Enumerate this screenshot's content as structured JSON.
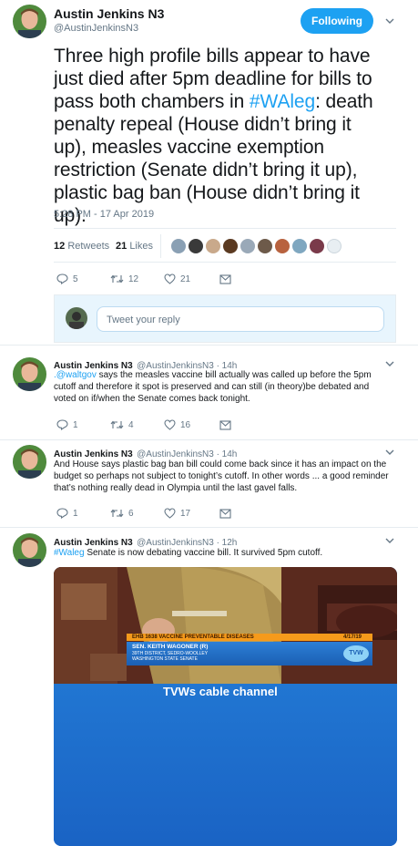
{
  "main_tweet": {
    "author_name": "Austin Jenkins N3",
    "author_handle": "@AustinJenkinsN3",
    "follow_label": "Following",
    "text_before": "Three high profile bills appear to have just died after 5pm deadline for bills to pass both chambers in ",
    "hashtag": "#WAleg",
    "text_after": ": death penalty repeal (House didn’t bring it up), measles vaccine exemption restriction (Senate didn’t bring it up), plastic bag ban (House didn’t bring it up).",
    "timestamp": "5:28 PM - 17 Apr 2019",
    "retweets_count": "12",
    "retweets_label": "Retweets",
    "likes_count": "21",
    "likes_label": "Likes",
    "reply_count": "5",
    "retweet_count_action": "12",
    "like_count_action": "21"
  },
  "reply_box": {
    "placeholder": "Tweet your reply"
  },
  "replies": [
    {
      "author_name": "Austin Jenkins N3",
      "meta": "@AustinJenkinsN3 · 14h",
      "mention": ".@waltgov",
      "text": " says the measles vaccine bill actually was called up before the 5pm cutoff and therefore it spot is preserved and can still (in theory)be debated and voted on if/when the Senate comes back tonight.",
      "reply_count": "1",
      "retweet_count": "4",
      "like_count": "16"
    },
    {
      "author_name": "Austin Jenkins N3",
      "meta": "@AustinJenkinsN3 · 14h",
      "text": "And House says plastic bag ban bill could come back since it has an impact on the budget so perhaps not subject to tonight’s cutoff. In other words ... a good reminder that’s nothing really dead in Olympia until the last gavel falls.",
      "reply_count": "1",
      "retweet_count": "6",
      "like_count": "17"
    },
    {
      "author_name": "Austin Jenkins N3",
      "meta": "@AustinJenkinsN3 · 12h",
      "hashtag": "#Waleg",
      "text": " Senate is now debating vaccine bill. It survived 5pm cutoff."
    }
  ],
  "video": {
    "bill_bar": "EHB 1638  VACCINE PREVENTABLE DISEASES",
    "date": "4/17/19",
    "speaker_name": "SEN. KEITH WAGONER (R)",
    "speaker_line2": "39TH DISTRICT, SEDRO-WOOLLEY",
    "speaker_line3": "WASHINGTON STATE SENATE",
    "caption": "TVWs cable channel",
    "logo": "TVW"
  },
  "colors": {
    "accent": "#1da1f2",
    "text": "#14171a",
    "muted": "#657786"
  }
}
